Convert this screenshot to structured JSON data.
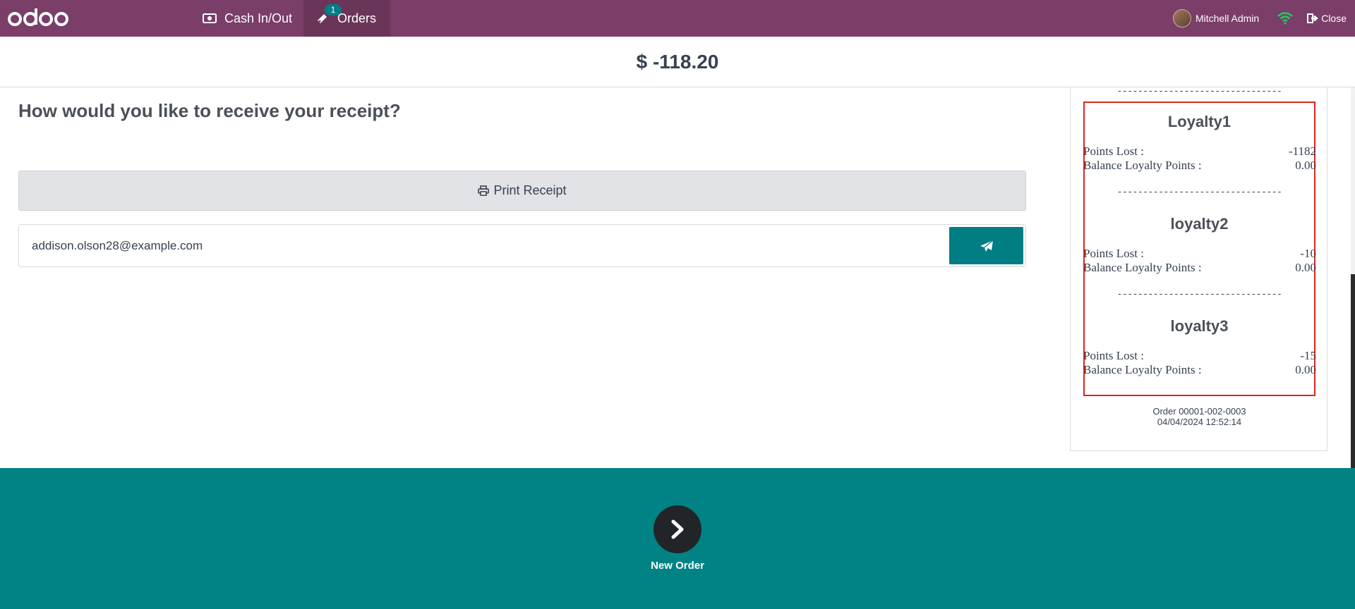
{
  "navbar": {
    "brand": "odoo",
    "cash_label": "Cash In/Out",
    "orders_label": "Orders",
    "orders_badge": "1",
    "user_name": "Mitchell Admin",
    "close_label": "Close",
    "colors": {
      "bar": "#7a3e68",
      "badge": "#017e84",
      "wifi": "#22c55e"
    }
  },
  "amount": "$ -118.20",
  "receipt_question": "How would you like to receive your receipt?",
  "print_label": "Print Receipt",
  "email_value": "addison.olson28@example.com",
  "receipt": {
    "separator": "--------------------------------",
    "programs": [
      {
        "name": "Loyalty1",
        "points_lost_label": "Points Lost :",
        "points_lost": "-1182",
        "balance_label": "Balance Loyalty Points :",
        "balance": "0.00"
      },
      {
        "name": "loyalty2",
        "points_lost_label": "Points Lost :",
        "points_lost": "-10",
        "balance_label": "Balance Loyalty Points :",
        "balance": "0.00"
      },
      {
        "name": "loyalty3",
        "points_lost_label": "Points Lost :",
        "points_lost": "-15",
        "balance_label": "Balance Loyalty Points :",
        "balance": "0.00"
      }
    ],
    "order_number": "Order 00001-002-0003",
    "order_date": "04/04/2024 12:52:14"
  },
  "footer": {
    "next_label": "New Order",
    "color": "#018385"
  }
}
